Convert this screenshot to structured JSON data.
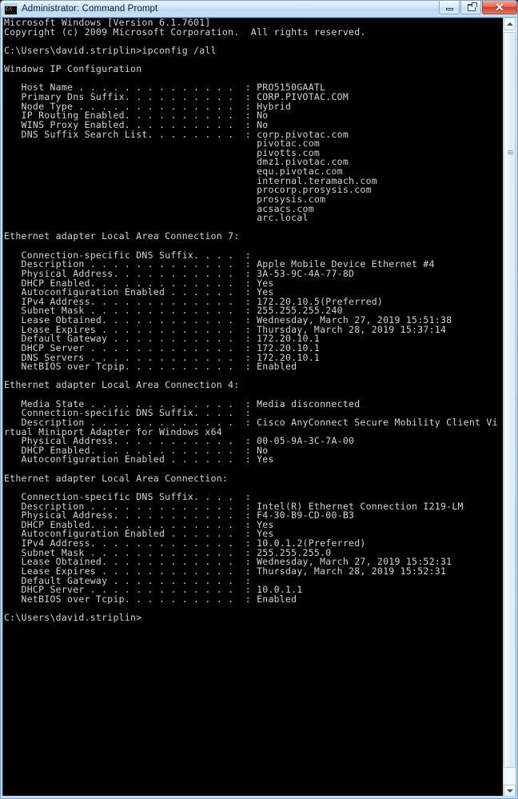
{
  "window": {
    "title": "Administrator: Command Prompt",
    "icon": "command-prompt-icon",
    "buttons": {
      "minimize": "minimize-icon",
      "maximize": "restore-icon",
      "close": "✕"
    }
  },
  "scrollbar": {
    "up_arrow": "scroll-up-arrow",
    "down_arrow": "scroll-down-arrow"
  },
  "console": {
    "prompt_path": "C:\\Users\\david.striplin",
    "command": "ipconfig /all",
    "header": {
      "os_line": "Microsoft Windows [Version 6.1.7601]",
      "copyright_line": "Copyright (c) 2009 Microsoft Corporation.  All rights reserved."
    },
    "ip_configuration": {
      "section_title": "Windows IP Configuration",
      "host_name": "PRO5150GAATL",
      "primary_dns_suffix": "CORP.PIVOTAC.COM",
      "node_type": "Hybrid",
      "ip_routing_enabled": "No",
      "wins_proxy_enabled": "No",
      "dns_suffix_search_list": [
        "corp.pivotac.com",
        "pivotac.com",
        "pivotts.com",
        "dmz1.pivotac.com",
        "equ.pivotac.com",
        "internal.teramach.com",
        "procorp.prosysis.com",
        "prosysis.com",
        "acsacs.com",
        "arc.local"
      ]
    },
    "adapters": [
      {
        "title": "Ethernet adapter Local Area Connection 7:",
        "connection_specific_dns_suffix": "",
        "description": "Apple Mobile Device Ethernet #4",
        "physical_address": "3A-53-9C-4A-77-8D",
        "dhcp_enabled": "Yes",
        "autoconfiguration_enabled": "Yes",
        "ipv4_address": "172.20.10.5(Preferred)",
        "subnet_mask": "255.255.255.240",
        "lease_obtained": "Wednesday, March 27, 2019 15:51:38",
        "lease_expires": "Thursday, March 28, 2019 15:37:14",
        "default_gateway": "172.20.10.1",
        "dhcp_server": "172.20.10.1",
        "dns_servers": "172.20.10.1",
        "netbios_over_tcpip": "Enabled"
      },
      {
        "title": "Ethernet adapter Local Area Connection 4:",
        "media_state": "Media disconnected",
        "connection_specific_dns_suffix": "",
        "description": "Cisco AnyConnect Secure Mobility Client Virtual Miniport Adapter for Windows x64",
        "physical_address": "00-05-9A-3C-7A-00",
        "dhcp_enabled": "No",
        "autoconfiguration_enabled": "Yes"
      },
      {
        "title": "Ethernet adapter Local Area Connection:",
        "connection_specific_dns_suffix": "",
        "description": "Intel(R) Ethernet Connection I219-LM",
        "physical_address": "F4-30-B9-CD-00-B3",
        "dhcp_enabled": "Yes",
        "autoconfiguration_enabled": "Yes",
        "ipv4_address": "10.0.1.2(Preferred)",
        "subnet_mask": "255.255.255.0",
        "lease_obtained": "Wednesday, March 27, 2019 15:52:31",
        "lease_expires": "Thursday, March 28, 2019 15:52:31",
        "default_gateway": "",
        "dhcp_server": "10.0.1.1",
        "netbios_over_tcpip": "Enabled"
      }
    ],
    "labels": {
      "host_name": "Host Name",
      "primary_dns_suffix": "Primary Dns Suffix",
      "node_type": "Node Type",
      "ip_routing_enabled": "IP Routing Enabled",
      "wins_proxy_enabled": "WINS Proxy Enabled",
      "dns_suffix_search_list": "DNS Suffix Search List",
      "connection_specific_dns_suffix": "Connection-specific DNS Suffix",
      "description": "Description",
      "physical_address": "Physical Address",
      "dhcp_enabled": "DHCP Enabled",
      "autoconfiguration_enabled": "Autoconfiguration Enabled",
      "ipv4_address": "IPv4 Address",
      "subnet_mask": "Subnet Mask",
      "lease_obtained": "Lease Obtained",
      "lease_expires": "Lease Expires",
      "default_gateway": "Default Gateway",
      "dhcp_server": "DHCP Server",
      "dns_servers": "DNS Servers",
      "netbios_over_tcpip": "NetBIOS over Tcpip",
      "media_state": "Media State"
    }
  }
}
